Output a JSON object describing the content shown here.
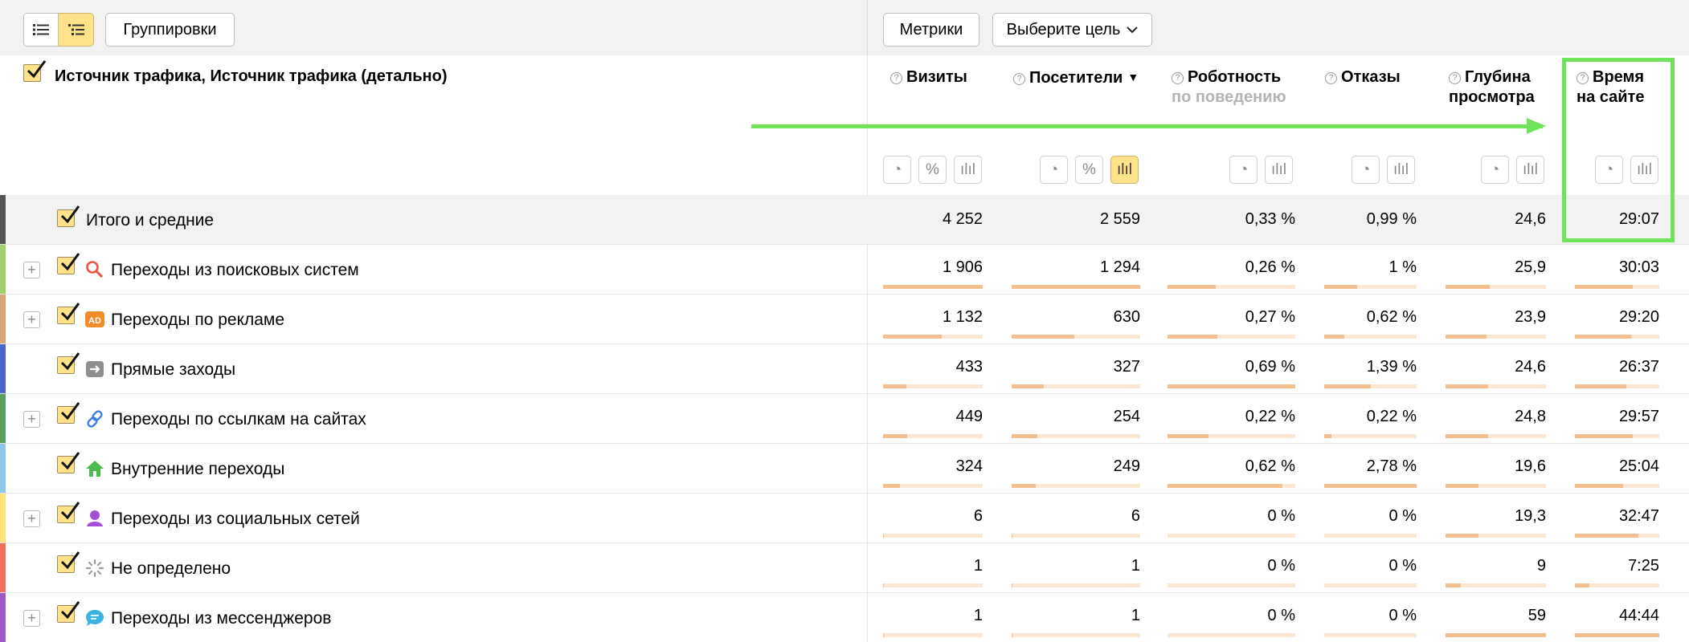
{
  "toolbar": {
    "groupings_label": "Группировки",
    "metrics_label": "Метрики",
    "goal_label": "Выберите цель"
  },
  "header": {
    "dimension_title": "Источник трафика, Источник трафика (детально)",
    "columns": [
      {
        "title": "Визиты",
        "subtitle": ""
      },
      {
        "title": "Посетители",
        "subtitle": "",
        "sorted": "▼"
      },
      {
        "title": "Роботность",
        "subtitle": "по поведению"
      },
      {
        "title": "Отказы",
        "subtitle": ""
      },
      {
        "title": "Глубина",
        "subtitle": "просмотра"
      },
      {
        "title": "Время",
        "subtitle": "на сайте"
      }
    ]
  },
  "total": {
    "label": "Итого и средние",
    "values": [
      "4 252",
      "2 559",
      "0,33 %",
      "0,99 %",
      "24,6",
      "29:07"
    ]
  },
  "rows": [
    {
      "label": "Переходы из поисковых систем",
      "expandable": true,
      "icon": "search-icon",
      "color": "#9ed06a",
      "values": [
        "1 906",
        "1 294",
        "0,26 %",
        "1 %",
        "25,9",
        "30:03"
      ],
      "bars": [
        1.0,
        1.0,
        0.38,
        0.36,
        0.44,
        0.69
      ]
    },
    {
      "label": "Переходы по рекламе",
      "expandable": true,
      "icon": "ad-icon",
      "color": "#d8a47a",
      "values": [
        "1 132",
        "630",
        "0,27 %",
        "0,62 %",
        "23,9",
        "29:20"
      ],
      "bars": [
        0.59,
        0.49,
        0.39,
        0.22,
        0.41,
        0.67
      ]
    },
    {
      "label": "Прямые заходы",
      "expandable": false,
      "icon": "direct-arrow-icon",
      "color": "#4a66c8",
      "values": [
        "433",
        "327",
        "0,69 %",
        "1,39 %",
        "24,6",
        "26:37"
      ],
      "bars": [
        0.23,
        0.25,
        1.0,
        0.5,
        0.42,
        0.61
      ]
    },
    {
      "label": "Переходы по ссылкам на сайтах",
      "expandable": true,
      "icon": "link-icon",
      "color": "#5aa05a",
      "values": [
        "449",
        "254",
        "0,22 %",
        "0,22 %",
        "24,8",
        "29:57"
      ],
      "bars": [
        0.24,
        0.2,
        0.32,
        0.08,
        0.42,
        0.69
      ]
    },
    {
      "label": "Внутренние переходы",
      "expandable": false,
      "icon": "home-icon",
      "color": "#8fc4ea",
      "values": [
        "324",
        "249",
        "0,62 %",
        "2,78 %",
        "19,6",
        "25:04"
      ],
      "bars": [
        0.17,
        0.19,
        0.9,
        1.0,
        0.33,
        0.57
      ]
    },
    {
      "label": "Переходы из социальных сетей",
      "expandable": true,
      "icon": "social-user-icon",
      "color": "#ffe27a",
      "values": [
        "6",
        "6",
        "0 %",
        "0 %",
        "19,3",
        "32:47"
      ],
      "bars": [
        0.005,
        0.005,
        0,
        0,
        0.33,
        0.75
      ]
    },
    {
      "label": "Не определено",
      "expandable": false,
      "icon": "loading-spinner-icon",
      "color": "#f07060",
      "values": [
        "1",
        "1",
        "0 %",
        "0 %",
        "9",
        "7:25"
      ],
      "bars": [
        0.002,
        0.002,
        0,
        0,
        0.15,
        0.17
      ]
    },
    {
      "label": "Переходы из мессенджеров",
      "expandable": true,
      "icon": "messenger-icon",
      "color": "#a05ac8",
      "values": [
        "1",
        "1",
        "0 %",
        "0 %",
        "59",
        "44:44"
      ],
      "bars": [
        0.002,
        0.002,
        0,
        0,
        1.0,
        1.0
      ]
    }
  ]
}
